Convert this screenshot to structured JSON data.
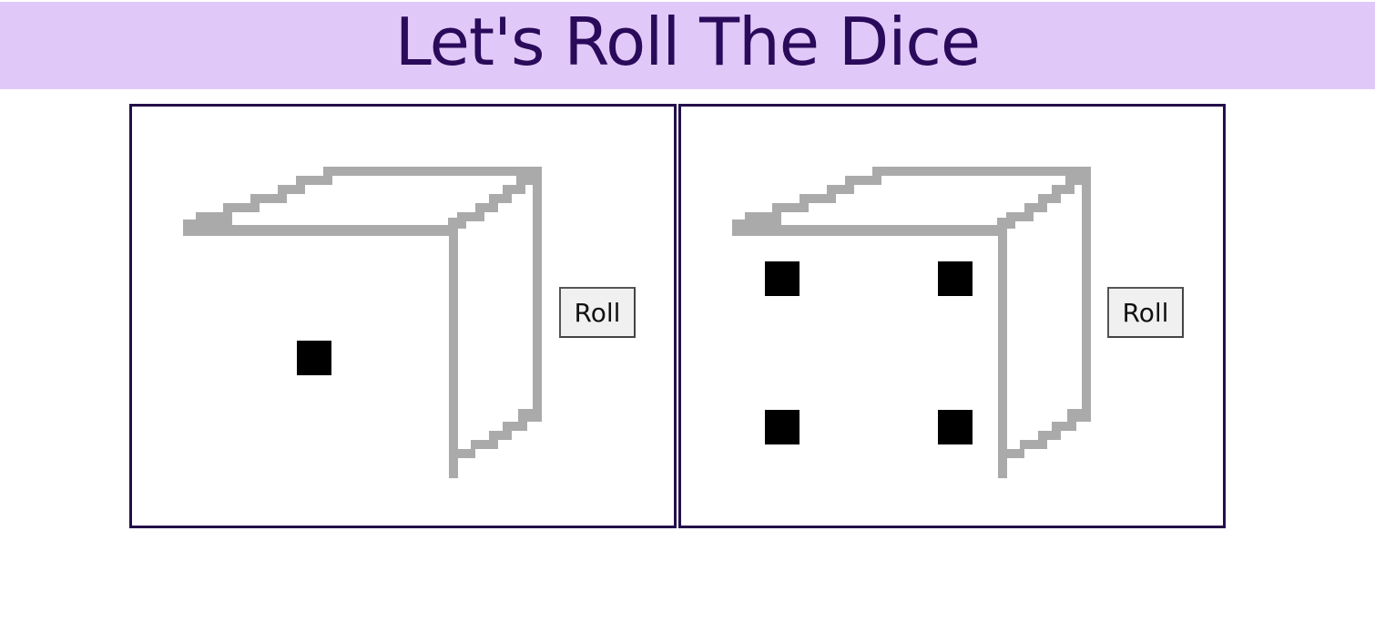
{
  "header": {
    "title": "Let's Roll The Dice"
  },
  "dice": [
    {
      "value": 1,
      "roll_label": "Roll"
    },
    {
      "value": 4,
      "roll_label": "Roll"
    }
  ],
  "colors": {
    "header_bg": "#e0c9f8",
    "title_text": "#2a0a5a",
    "panel_border": "#24104a",
    "die_outline": "#aaaaaa",
    "pip": "#000000"
  },
  "icons": {
    "die": "pixel-die-icon",
    "pip": "square-pip"
  }
}
